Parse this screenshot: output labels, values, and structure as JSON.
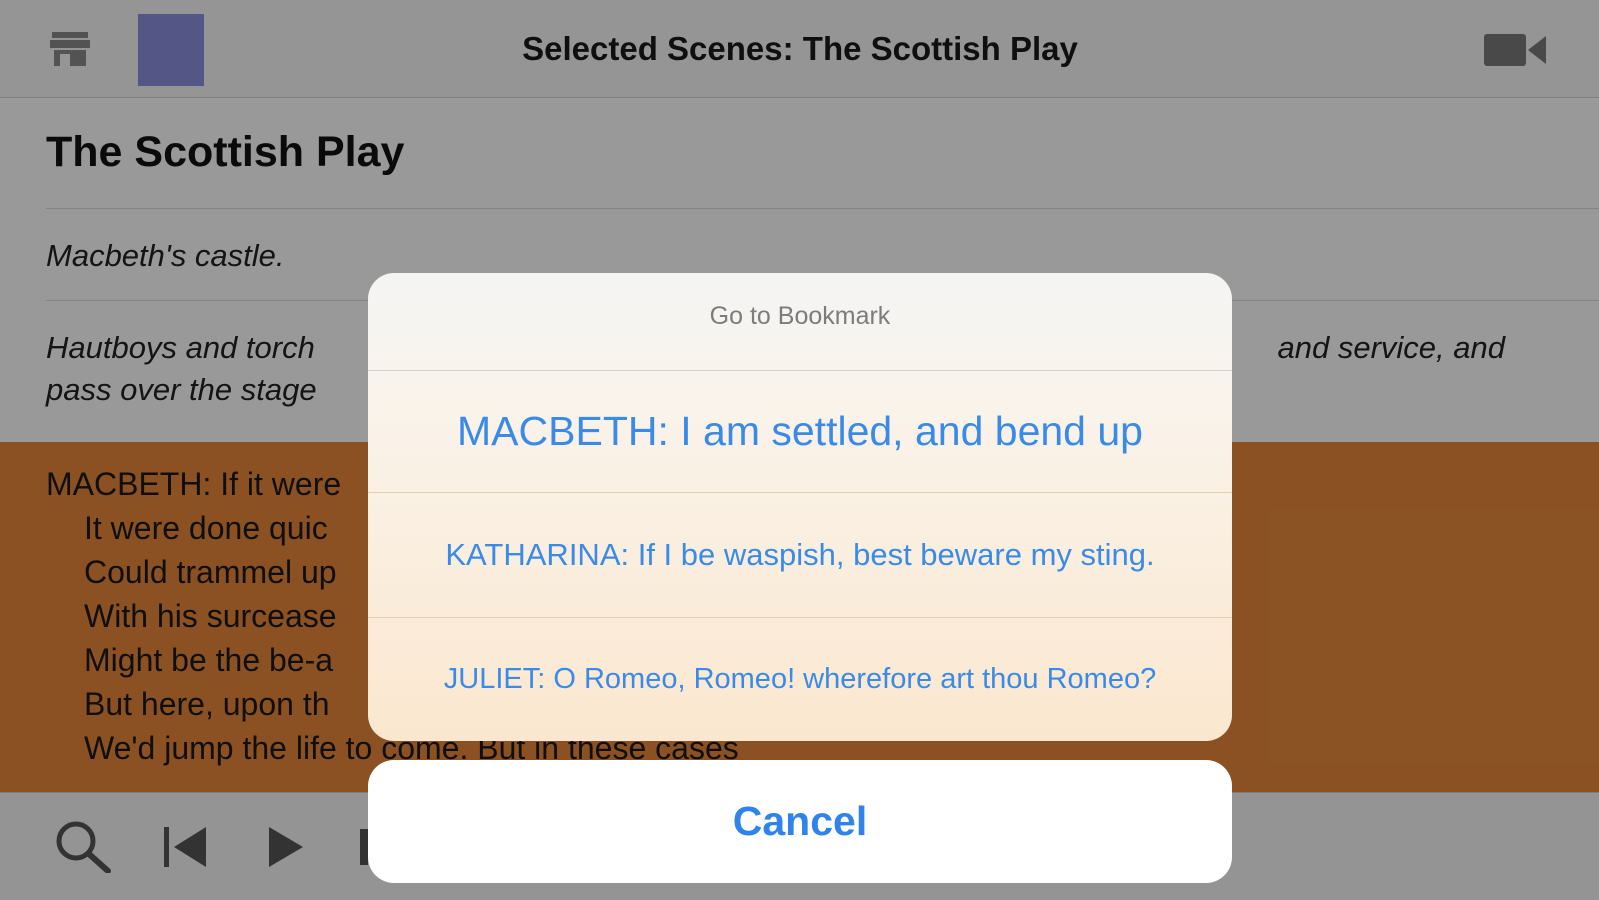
{
  "navbar": {
    "title": "Selected Scenes: The Scottish Play"
  },
  "document": {
    "play_title": "The Scottish Play",
    "setting": "Macbeth's castle.",
    "stage_direction_left_1": "Hautboys and torch",
    "stage_direction_left_2": "pass over the stage",
    "stage_direction_right": "and service, and",
    "speech_lines": [
      "MACBETH: If it were",
      "It were done quic",
      "Could trammel up",
      "With his surcease",
      "Might be the be-a",
      "But here, upon th",
      "We'd jump the life to come. But in these cases"
    ],
    "highlight_color": "#e8883a"
  },
  "action_sheet": {
    "title": "Go to Bookmark",
    "options": [
      "MACBETH: I am settled, and bend up",
      "KATHARINA: If I be waspish, best beware my sting.",
      "JULIET: O Romeo, Romeo! wherefore art thou Romeo?"
    ],
    "cancel_label": "Cancel",
    "accent_color": "#3a8be8"
  },
  "icons": {
    "store": "store-icon",
    "video": "video-camera-icon",
    "search": "search-icon",
    "previous": "skip-back-icon",
    "play": "play-icon"
  }
}
